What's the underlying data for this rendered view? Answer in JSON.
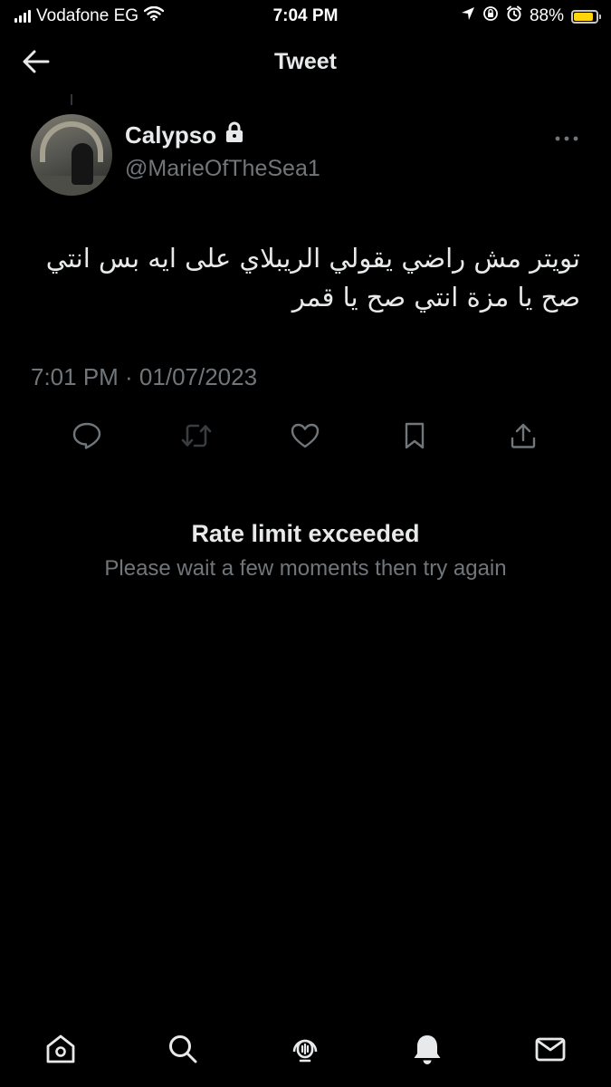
{
  "status_bar": {
    "carrier": "Vodafone EG",
    "time": "7:04 PM",
    "battery_percent": "88%",
    "battery_level": 0.88,
    "icons": [
      "signal-icon",
      "wifi-icon",
      "location-icon",
      "orientation-lock-icon",
      "alarm-icon",
      "battery-icon"
    ]
  },
  "header": {
    "title": "Tweet",
    "back_icon": "back-arrow-icon"
  },
  "tweet": {
    "display_name": "Calypso",
    "handle": "@MarieOfTheSea1",
    "protected_icon": "lock-icon",
    "text_lines": [
      "تويتر مش راضي يقولي الريبلاي على ايه بس انتي",
      "صح يا مزة انتي صح يا قمر"
    ],
    "timestamp": "7:01 PM · 01/07/2023",
    "actions": [
      "reply-icon",
      "retweet-icon",
      "like-icon",
      "bookmark-icon",
      "share-icon"
    ]
  },
  "rate_limit": {
    "title": "Rate limit exceeded",
    "message": "Please wait a few moments then try again"
  },
  "bottom_nav": [
    "home-icon",
    "search-icon",
    "spaces-icon",
    "notifications-icon",
    "messages-icon"
  ],
  "colors": {
    "background": "#000000",
    "primary_text": "#e7e9ea",
    "secondary_text": "#71767b",
    "battery": "#ffd60a"
  }
}
